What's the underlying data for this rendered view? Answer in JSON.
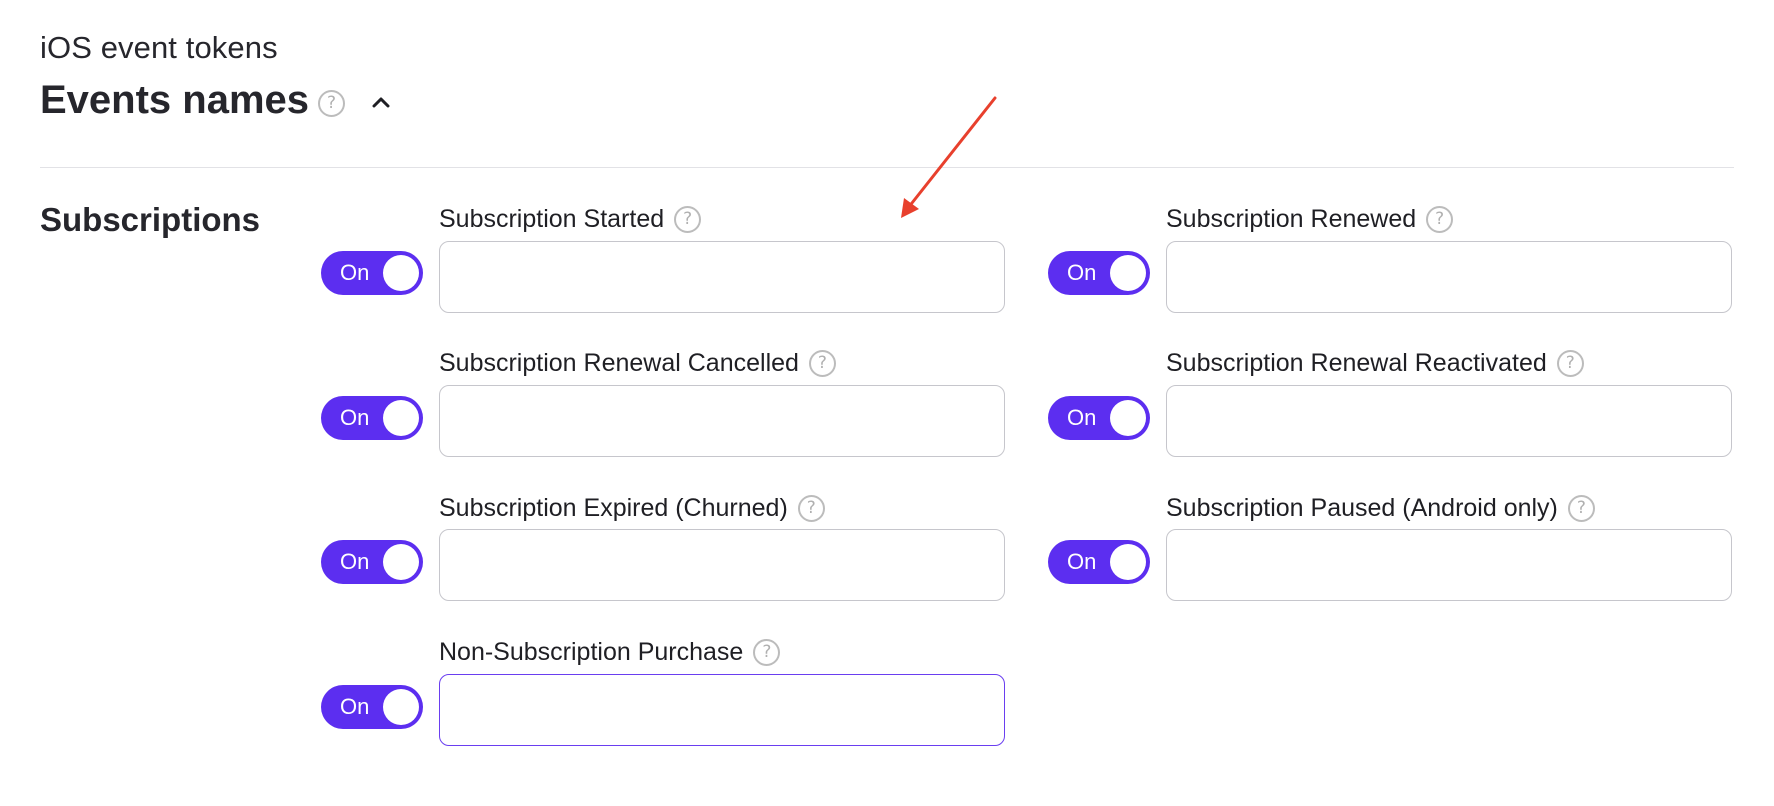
{
  "header": {
    "kicker": "iOS event tokens",
    "title": "Events names",
    "help_symbol": "?"
  },
  "section": {
    "label": "Subscriptions"
  },
  "colors": {
    "toggle_on": "#5c2ef0",
    "annotation_arrow": "#e8402d",
    "focused_border": "#6a3ef0"
  },
  "fields": [
    {
      "label": "Subscription Started",
      "toggle": "On",
      "value": "",
      "placeholder": ""
    },
    {
      "label": "Subscription Renewed",
      "toggle": "On",
      "value": "",
      "placeholder": ""
    },
    {
      "label": "Subscription Renewal Cancelled",
      "toggle": "On",
      "value": "",
      "placeholder": ""
    },
    {
      "label": "Subscription Renewal Reactivated",
      "toggle": "On",
      "value": "",
      "placeholder": ""
    },
    {
      "label": "Subscription Expired (Churned)",
      "toggle": "On",
      "value": "",
      "placeholder": ""
    },
    {
      "label": "Subscription Paused (Android only)",
      "toggle": "On",
      "value": "",
      "placeholder": ""
    },
    {
      "label": "Non-Subscription Purchase",
      "toggle": "On",
      "value": "",
      "placeholder": ""
    }
  ]
}
